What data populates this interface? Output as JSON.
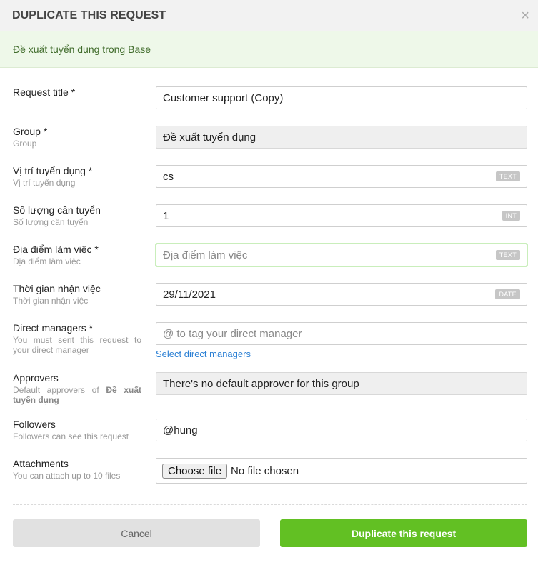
{
  "dialog": {
    "title": "DUPLICATE THIS REQUEST",
    "close_symbol": "×",
    "subtitle": "Đề xuất tuyển dụng trong Base"
  },
  "form": {
    "request_title": {
      "label": "Request title *",
      "value": "Customer support (Copy)"
    },
    "group": {
      "label": "Group *",
      "desc": "Group",
      "value": "Đề xuất tuyển dụng"
    },
    "position": {
      "label": "Vị trí tuyển dụng *",
      "desc": "Vị trí tuyển dụng",
      "value": "cs",
      "type_badge": "TEXT"
    },
    "quantity": {
      "label": "Số lượng cần tuyển",
      "desc": "Số lượng cần tuyển",
      "value": "1",
      "type_badge": "INT"
    },
    "location": {
      "label": "Địa điểm làm việc *",
      "desc": "Địa điểm làm việc",
      "placeholder": "Địa điểm làm việc",
      "type_badge": "TEXT"
    },
    "start_time": {
      "label": "Thời gian nhận việc",
      "desc": "Thời gian nhận việc",
      "value": "29/11/2021",
      "type_badge": "DATE"
    },
    "direct_managers": {
      "label": "Direct managers *",
      "desc": "You must sent this request to your direct manager",
      "placeholder": "@ to tag your direct manager",
      "link": "Select direct managers"
    },
    "approvers": {
      "label": "Approvers",
      "desc_prefix": "Default approvers of",
      "desc_group": "Đề xuất tuyển dụng",
      "value": "There's no default approver for this group"
    },
    "followers": {
      "label": "Followers",
      "desc": "Followers can see this request",
      "value": "@hung"
    },
    "attachments": {
      "label": "Attachments",
      "desc": "You can attach up to 10 files",
      "button": "Choose file",
      "status": "No file chosen"
    }
  },
  "actions": {
    "cancel": "Cancel",
    "submit": "Duplicate this request"
  },
  "colors": {
    "accent_green": "#62c023",
    "subtitle_bg": "#eef8e9",
    "link_blue": "#2a7fd4"
  }
}
